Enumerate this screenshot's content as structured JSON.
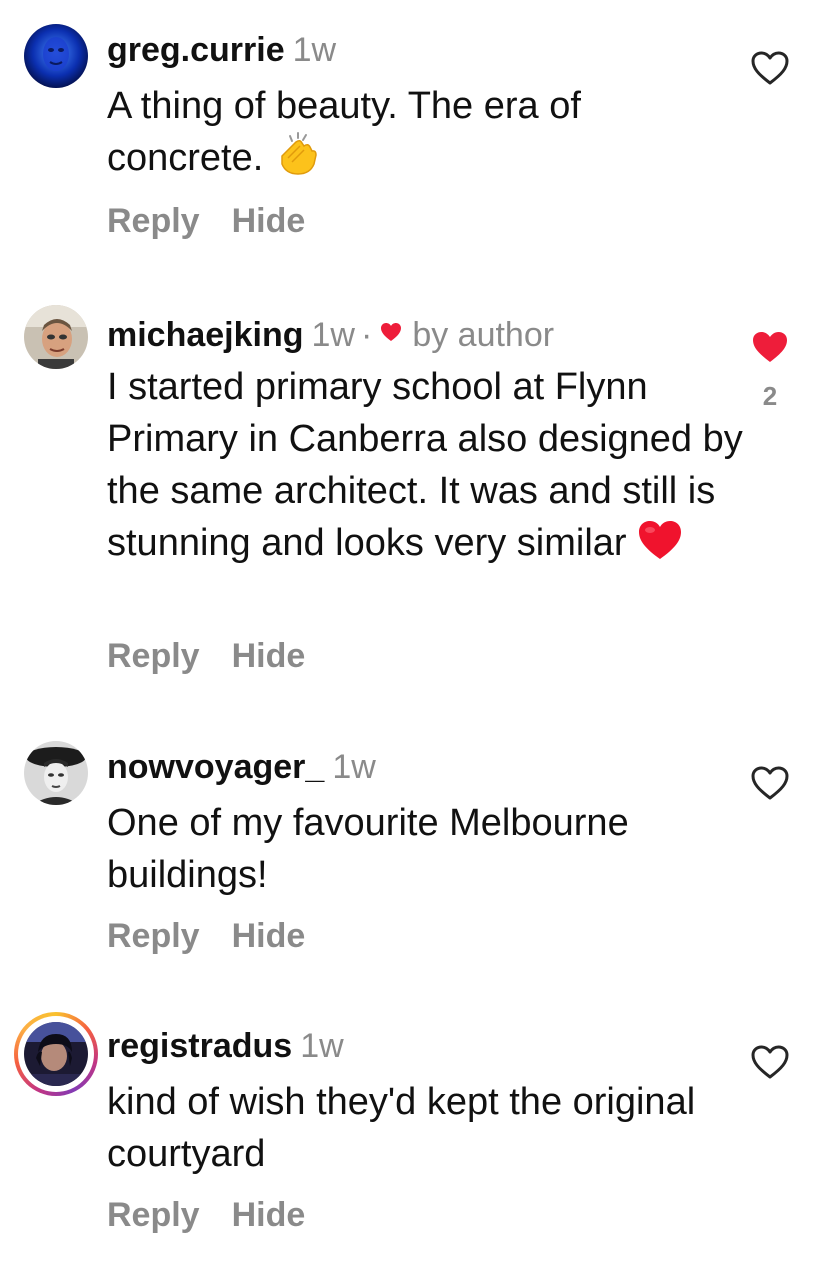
{
  "comments": [
    {
      "username": "greg.currie",
      "time": "1w",
      "text": "A thing of beauty. The era of concrete.",
      "emoji": "clapping-hands",
      "reply_label": "Reply",
      "hide_label": "Hide",
      "liked": false
    },
    {
      "username": "michaejking",
      "time": "1w",
      "separator": "·",
      "author_badge": "by author",
      "text": "I started primary school at Flynn Primary in Canberra also designed by the same architect. It was and still is stunning and looks very similar",
      "emoji": "red-heart",
      "reply_label": "Reply",
      "hide_label": "Hide",
      "liked": true,
      "like_count": "2"
    },
    {
      "username": "nowvoyager_",
      "time": "1w",
      "text": "One of my favourite Melbourne buildings!",
      "reply_label": "Reply",
      "hide_label": "Hide",
      "liked": false
    },
    {
      "username": "registradus",
      "time": "1w",
      "text": "kind of wish they'd kept the original courtyard",
      "reply_label": "Reply",
      "hide_label": "Hide",
      "liked": false,
      "story_ring": true
    }
  ],
  "colors": {
    "secondary_text": "#8a8a8a",
    "like_red": "#ee1d3a",
    "story_ring": [
      "#f9c12e",
      "#f56040",
      "#c13584",
      "#833ab4"
    ]
  }
}
